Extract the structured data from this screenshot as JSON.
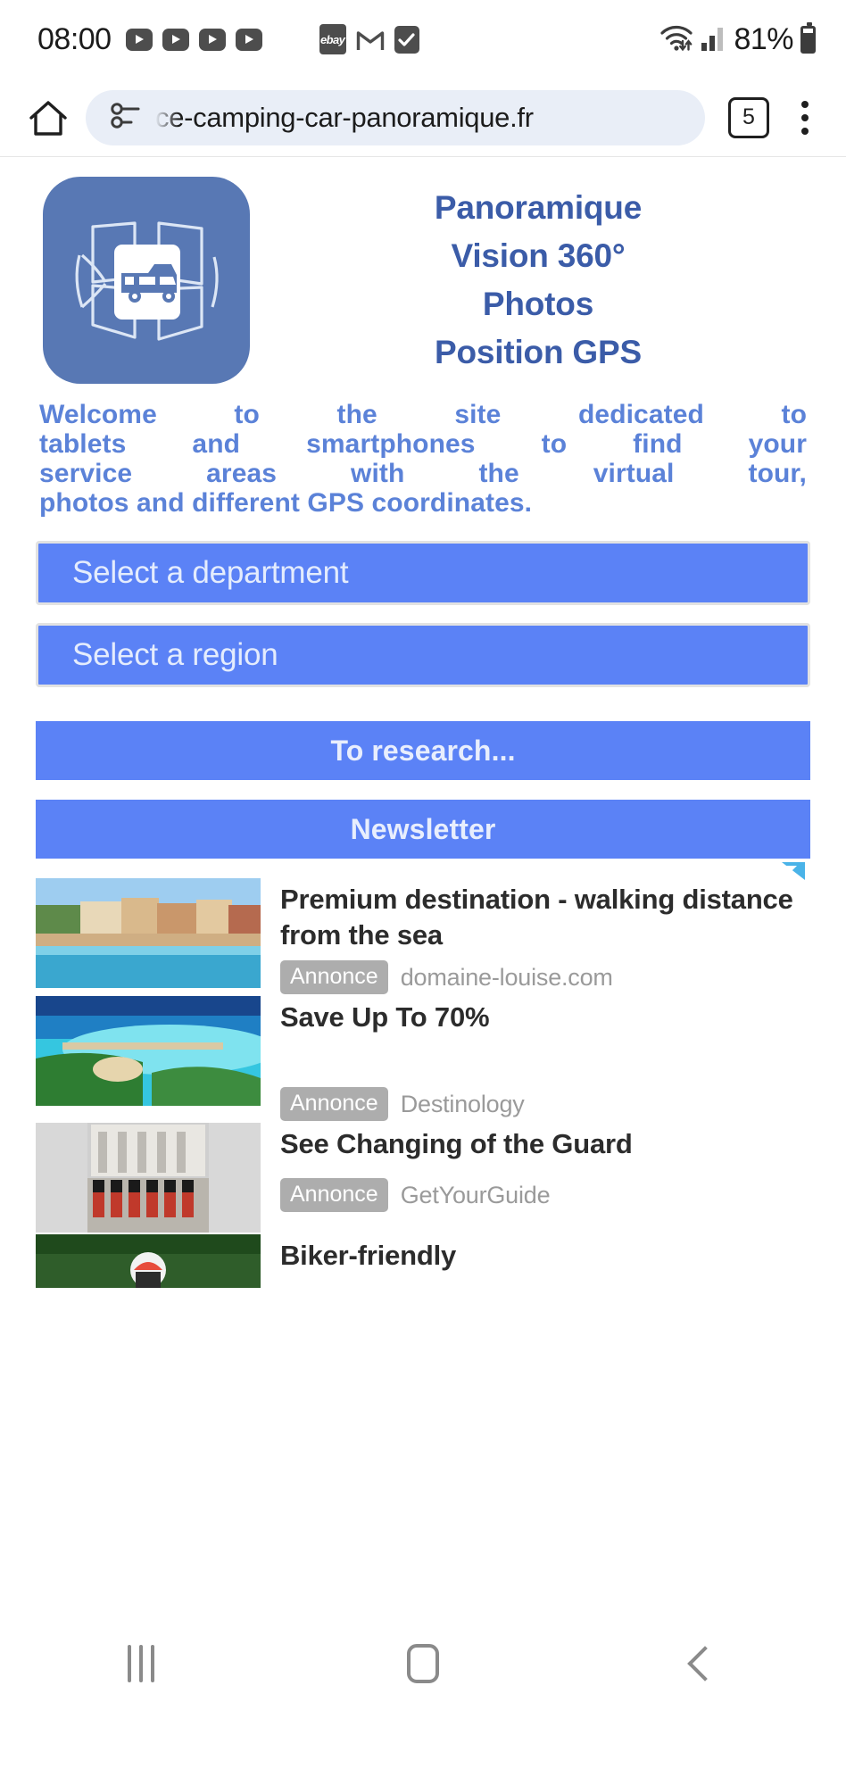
{
  "status_bar": {
    "time": "08:00",
    "battery_percent": "81%",
    "app_icons": [
      "youtube-icon",
      "youtube-icon",
      "youtube-icon",
      "youtube-icon",
      "ebay-icon",
      "gmail-icon",
      "checkmark-icon"
    ],
    "ebay_label": "ebay",
    "connectivity_icons": [
      "wifi-icon",
      "signal-bars-icon",
      "battery-icon"
    ]
  },
  "browser": {
    "url": "ce-camping-car-panoramique.fr",
    "tab_count": "5",
    "icons": {
      "home": "home-icon",
      "permission": "permission-info-icon",
      "menu": "kebab-menu-icon"
    }
  },
  "site": {
    "logo_alt": "camper-panorama-logo",
    "title_lines": [
      "Panoramique",
      "Vision 360°",
      "Photos",
      "Position GPS"
    ],
    "welcome_lines": [
      "Welcome to the site dedicated to",
      "tablets and smartphones to find your",
      "service areas with the virtual tour,",
      "photos and different GPS coordinates."
    ],
    "selects": [
      {
        "label": "Select a department"
      },
      {
        "label": "Select a region"
      }
    ],
    "buttons": [
      {
        "label": "To research..."
      },
      {
        "label": "Newsletter"
      }
    ],
    "colors": {
      "brand_blue": "#5b82f6",
      "title_blue": "#3b5ca8",
      "welcome_blue": "#5b82d8",
      "logo_blue": "#5878b4"
    }
  },
  "ads": {
    "adchoices_icon": "adchoices-icon",
    "annonce_label": "Annonce",
    "items": [
      {
        "title": "Premium destination - walking distance from the sea",
        "advertiser": "domaine-louise.com",
        "image": "coastal-village-photo"
      },
      {
        "title": "Save Up To 70%",
        "advertiser": "Destinology",
        "image": "tropical-resort-photo"
      },
      {
        "title": "See Changing of the Guard",
        "advertiser": "GetYourGuide",
        "image": "royal-guards-photo"
      },
      {
        "title": "Biker-friendly",
        "advertiser": "",
        "image": "motorcycle-photo"
      }
    ]
  },
  "nav_bar": {
    "items": [
      "recents-icon",
      "home-square-icon",
      "back-chevron-icon"
    ]
  }
}
